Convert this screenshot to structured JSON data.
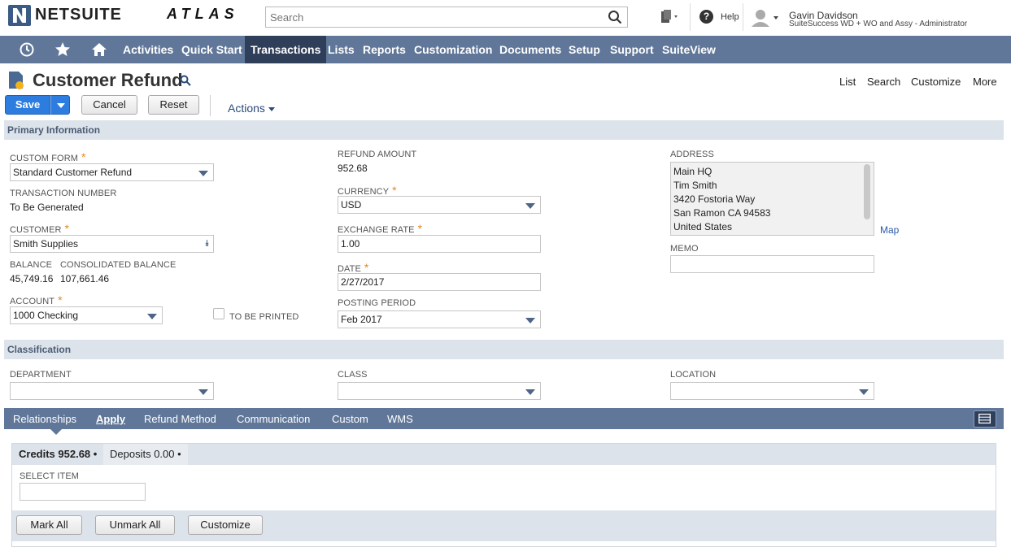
{
  "header": {
    "logo_text": "NETSUITE",
    "atlas_text": "ATLAS",
    "search_placeholder": "Search",
    "help_label": "Help",
    "user_name": "Gavin Davidson",
    "user_role": "SuiteSuccess WD + WO and Assy - Administrator"
  },
  "nav": {
    "items": [
      "Activities",
      "Quick Start",
      "Transactions",
      "Lists",
      "Reports",
      "Customization",
      "Documents",
      "Setup",
      "Support",
      "SuiteView"
    ],
    "active": "Transactions"
  },
  "page": {
    "title": "Customer Refund",
    "top_links": [
      "List",
      "Search",
      "Customize",
      "More"
    ],
    "save_label": "Save",
    "cancel_label": "Cancel",
    "reset_label": "Reset",
    "actions_label": "Actions"
  },
  "primary": {
    "section_title": "Primary Information",
    "custom_form_label": "CUSTOM FORM",
    "custom_form_value": "Standard Customer Refund",
    "transaction_number_label": "TRANSACTION NUMBER",
    "transaction_number_value": "To Be Generated",
    "customer_label": "CUSTOMER",
    "customer_value": "Smith Supplies",
    "balance_label": "BALANCE",
    "balance_value": "45,749.16",
    "consolidated_balance_label": "CONSOLIDATED BALANCE",
    "consolidated_balance_value": "107,661.46",
    "account_label": "ACCOUNT",
    "account_value": "1000 Checking",
    "to_be_printed_label": "TO BE PRINTED",
    "refund_amount_label": "REFUND AMOUNT",
    "refund_amount_value": "952.68",
    "currency_label": "CURRENCY",
    "currency_value": "USD",
    "exchange_rate_label": "EXCHANGE RATE",
    "exchange_rate_value": "1.00",
    "date_label": "DATE",
    "date_value": "2/27/2017",
    "posting_period_label": "POSTING PERIOD",
    "posting_period_value": "Feb 2017",
    "address_label": "ADDRESS",
    "address_lines": [
      "Main HQ",
      "Tim Smith",
      "3420 Fostoria Way",
      "San Ramon CA 94583",
      "United States"
    ],
    "map_link": "Map",
    "memo_label": "MEMO",
    "memo_value": ""
  },
  "classification": {
    "section_title": "Classification",
    "department_label": "DEPARTMENT",
    "class_label": "CLASS",
    "location_label": "LOCATION"
  },
  "subtabs": {
    "items": [
      "Relationships",
      "Apply",
      "Refund Method",
      "Communication",
      "Custom",
      "WMS"
    ],
    "active": "Apply"
  },
  "apply": {
    "tab_credits": "Credits 952.68 •",
    "tab_deposits": "Deposits 0.00 •",
    "select_item_label": "SELECT ITEM",
    "mark_all": "Mark All",
    "unmark_all": "Unmark All",
    "customize": "Customize"
  },
  "colors": {
    "nav_bg": "#607799",
    "nav_active": "#2f3f5a",
    "save_blue": "#2d7de0",
    "section_bg": "#dde3ea",
    "required": "#e08a2b"
  }
}
